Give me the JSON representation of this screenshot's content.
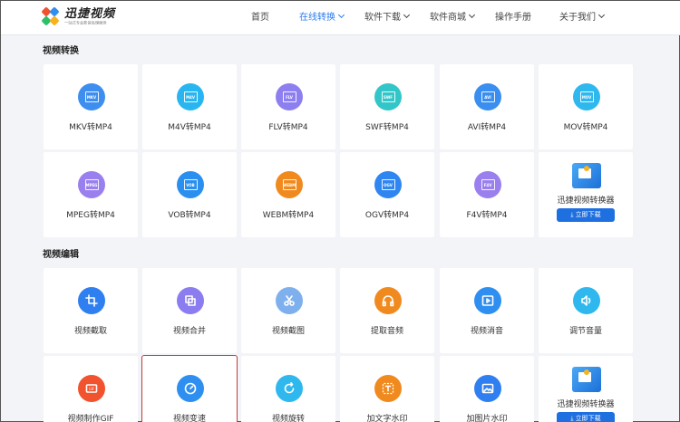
{
  "header": {
    "logo_title": "迅捷视频",
    "logo_sub": "一站式专业影音处理服务",
    "nav": [
      {
        "label": "首页",
        "dropdown": false,
        "active": false
      },
      {
        "label": "在线转换",
        "dropdown": true,
        "active": true
      },
      {
        "label": "软件下载",
        "dropdown": true,
        "active": false
      },
      {
        "label": "软件商城",
        "dropdown": true,
        "active": false
      },
      {
        "label": "操作手册",
        "dropdown": false,
        "active": false
      },
      {
        "label": "关于我们",
        "dropdown": true,
        "active": false
      }
    ]
  },
  "sections": {
    "convert_title": "视频转换",
    "edit_title": "视频编辑"
  },
  "convert_cards": [
    {
      "label": "MKV转MP4",
      "badge": "MKV",
      "color": "#3e8ef0"
    },
    {
      "label": "M4V转MP4",
      "badge": "M4V",
      "color": "#29b6f0"
    },
    {
      "label": "FLV转MP4",
      "badge": "FLV",
      "color": "#8d7ff0"
    },
    {
      "label": "SWF转MP4",
      "badge": "SWF",
      "color": "#33c6c9"
    },
    {
      "label": "AVI转MP4",
      "badge": "AVI",
      "color": "#3a8ef0"
    },
    {
      "label": "MOV转MP4",
      "badge": "MOV",
      "color": "#2fb8ee"
    },
    {
      "label": "MPEG转MP4",
      "badge": "MPEG",
      "color": "#9a80ee"
    },
    {
      "label": "VOB转MP4",
      "badge": "VOB",
      "color": "#2b8ff0"
    },
    {
      "label": "WEBM转MP4",
      "badge": "WEBM",
      "color": "#f08a1e"
    },
    {
      "label": "OGV转MP4",
      "badge": "OGV",
      "color": "#2f86f0"
    },
    {
      "label": "F4V转MP4",
      "badge": "F4V",
      "color": "#9a80ee"
    }
  ],
  "edit_cards": [
    {
      "label": "视频截取",
      "icon": "crop-icon",
      "color": "#2f7ff0"
    },
    {
      "label": "视频合并",
      "icon": "merge-icon",
      "color": "#8b7cf0"
    },
    {
      "label": "视频截图",
      "icon": "scissors-icon",
      "color": "#7fb0ee"
    },
    {
      "label": "提取音频",
      "icon": "headphones-icon",
      "color": "#f08a1e"
    },
    {
      "label": "视频消音",
      "icon": "mute-video-icon",
      "color": "#2f8ff0"
    },
    {
      "label": "调节音量",
      "icon": "volume-icon",
      "color": "#2fb8ee"
    },
    {
      "label": "视频制作GIF",
      "icon": "gif-icon",
      "color": "#f0532e"
    },
    {
      "label": "视频变速",
      "icon": "speedometer-icon",
      "color": "#2f8ff0"
    },
    {
      "label": "视频旋转",
      "icon": "rotate-icon",
      "color": "#2fb8ee"
    },
    {
      "label": "加文字水印",
      "icon": "text-watermark-icon",
      "color": "#f08a1e"
    },
    {
      "label": "加图片水印",
      "icon": "image-watermark-icon",
      "color": "#2f7ff0"
    }
  ],
  "promo": {
    "title": "迅捷视频转换器",
    "button": "立即下载"
  }
}
